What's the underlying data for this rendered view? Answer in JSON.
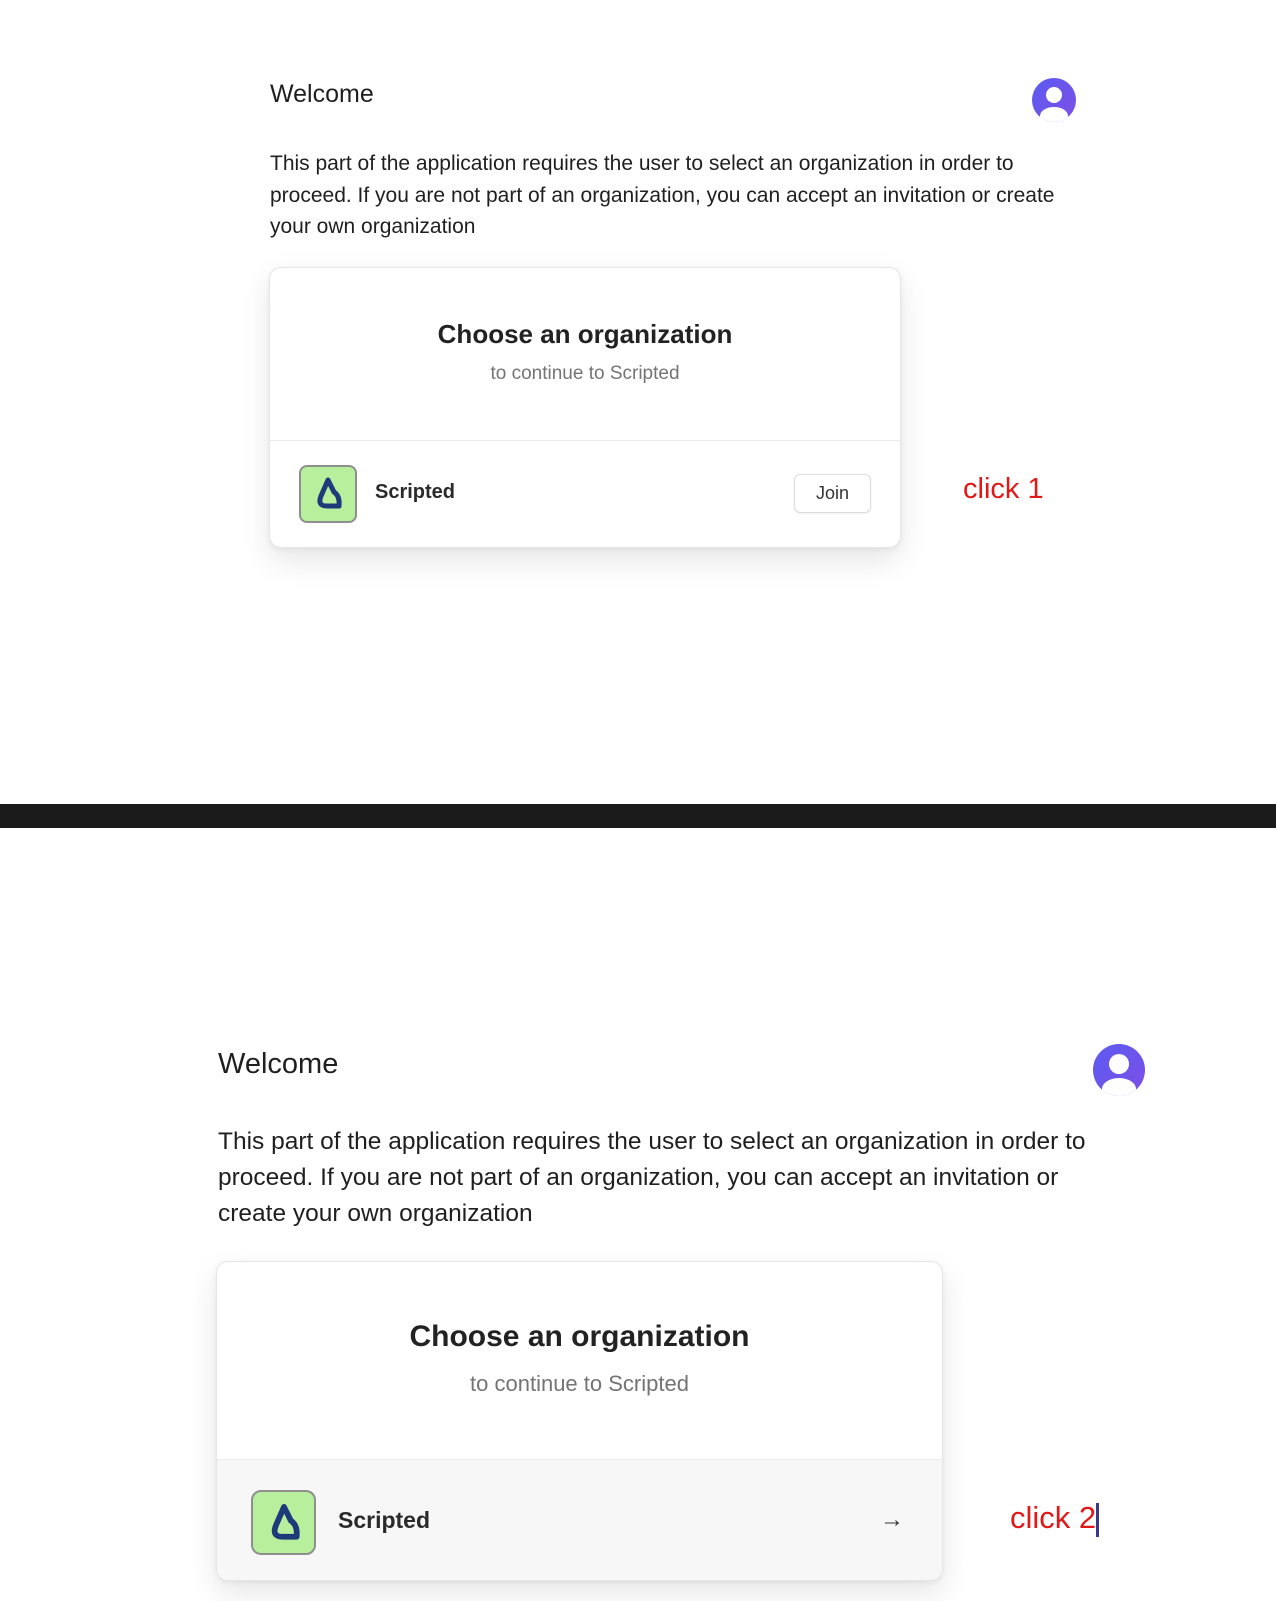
{
  "panels": [
    {
      "welcome": "Welcome",
      "description": "This part of the application requires the user to select an organization in order to proceed. If you are not part of an organization, you can accept an invitation or create your own organization",
      "card": {
        "title": "Choose an organization",
        "subtitle": "to continue to Scripted",
        "org_name": "Scripted",
        "action_label": "Join"
      },
      "annotation": "click 1"
    },
    {
      "welcome": "Welcome",
      "description": "This part of the application requires the user to select an organization in order to proceed. If you are not part of an organization, you can accept an invitation or create your own organization",
      "card": {
        "title": "Choose an organization",
        "subtitle": "to continue to Scripted",
        "org_name": "Scripted",
        "action_icon": "arrow-right-icon"
      },
      "annotation": "click 2"
    }
  ],
  "colors": {
    "avatar_gradient_start": "#5b5cf0",
    "avatar_gradient_end": "#7e4ee8",
    "logo_background": "#b7ef9c",
    "logo_mark": "#1e3a7a",
    "annotation_text": "#e01818",
    "divider": "#1b1b1b"
  }
}
